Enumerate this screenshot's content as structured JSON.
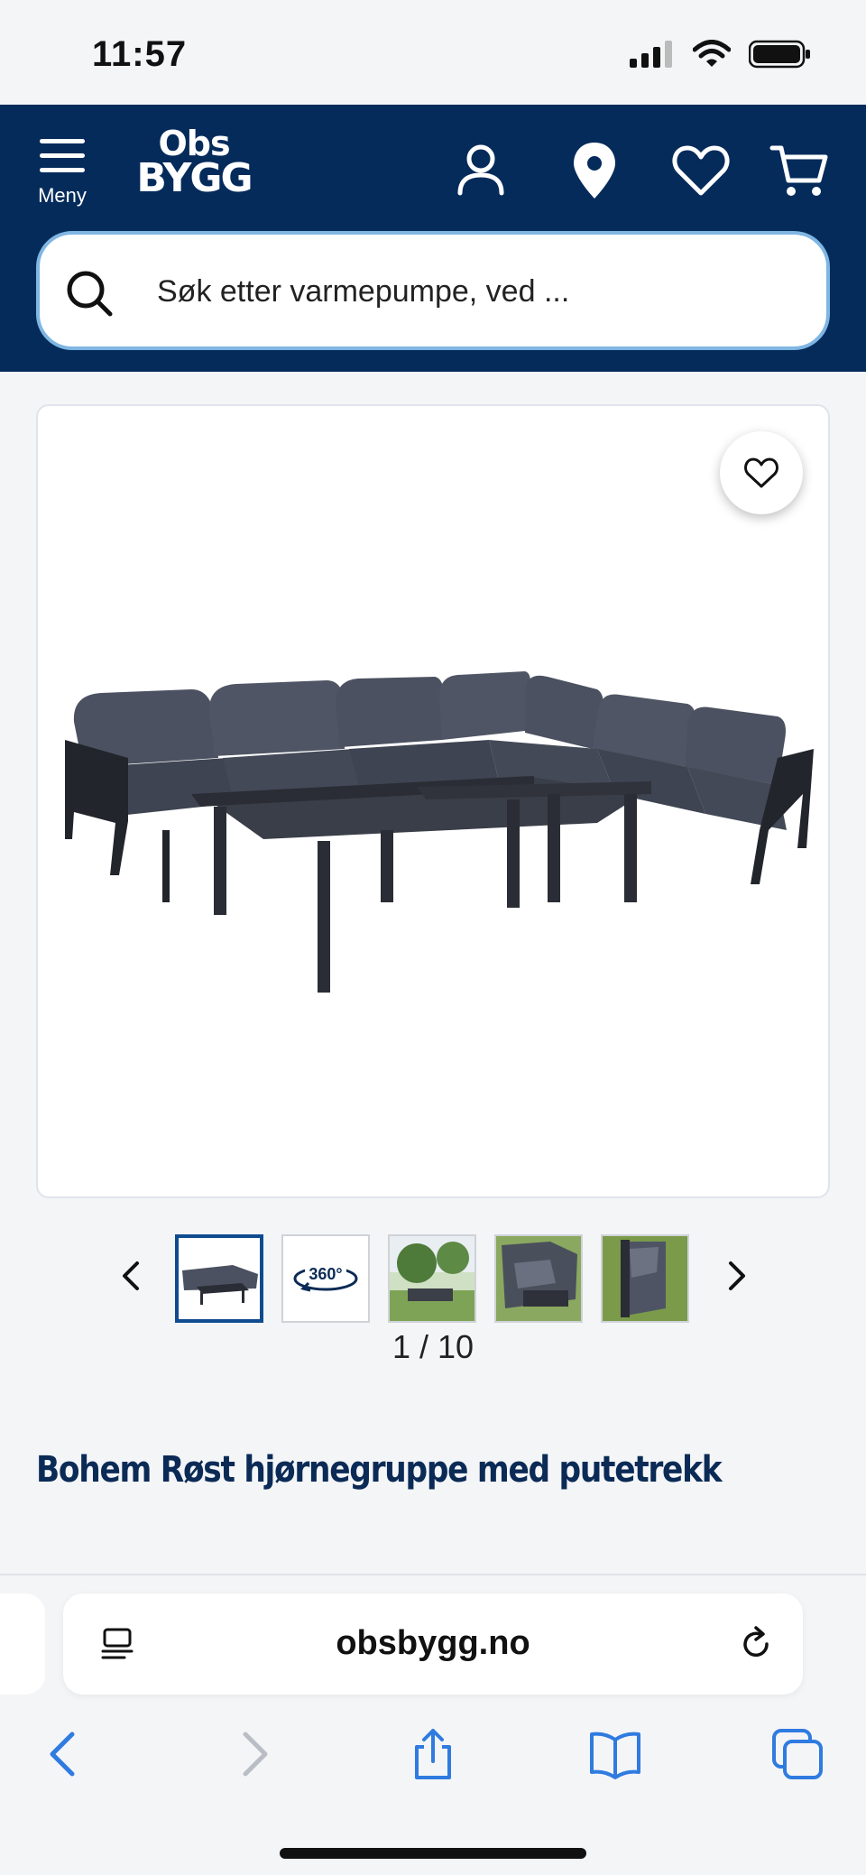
{
  "status_bar": {
    "time": "11:57"
  },
  "header": {
    "menu_label": "Meny",
    "logo_line1": "Obs",
    "logo_line2": "BYGG",
    "icons": [
      "user-icon",
      "location-pin-icon",
      "heart-icon",
      "cart-icon"
    ],
    "brand_color": "#052b5b"
  },
  "search": {
    "placeholder": "Søk etter varmepumpe, ved ..."
  },
  "gallery": {
    "counter": "1 / 10",
    "thumbnails": [
      "sofa-set",
      "360-view",
      "garden-photo",
      "sofa-closeup",
      "armrest-closeup"
    ]
  },
  "product": {
    "title": "Bohem Røst hjørnegruppe med putetrekk"
  },
  "browser": {
    "url": "obsbygg.no"
  }
}
